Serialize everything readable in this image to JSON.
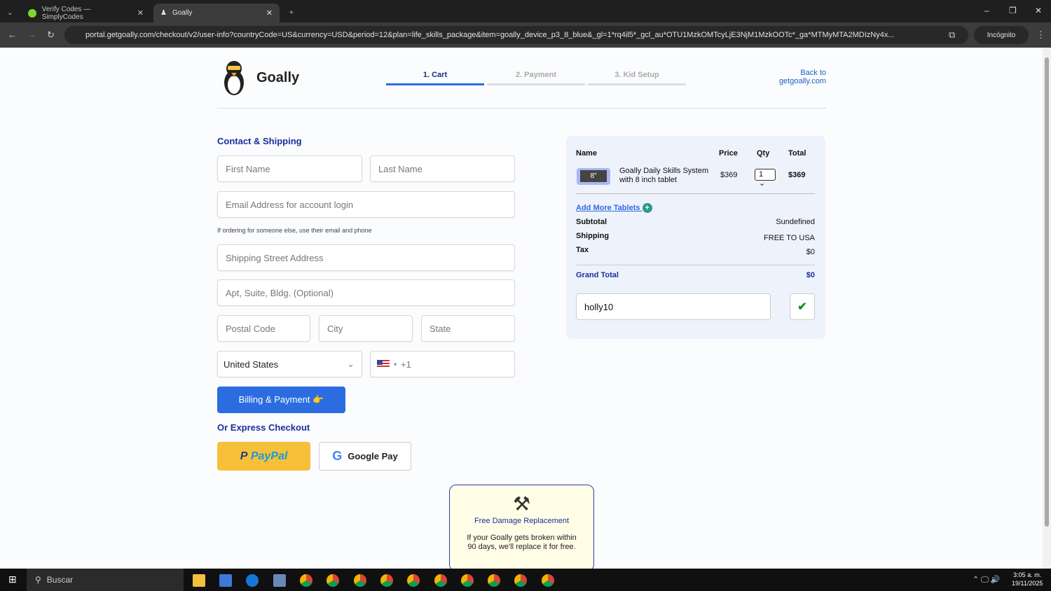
{
  "browser": {
    "tabs": [
      {
        "title": "Verify Codes — SimplyCodes"
      },
      {
        "title": "Goally"
      }
    ],
    "url": "portal.getgoally.com/checkout/v2/user-info?countryCode=US&currency=USD&period=12&plan=life_skills_package&item=goally_device_p3_8_blue&_gl=1*rq4il5*_gcl_au*OTU1MzkOMTcyLjE3NjM1MzkOOTc*_ga*MTMyMTA2MDIzNy4x...",
    "incognito": "Incógnito"
  },
  "header": {
    "brand": "Goally",
    "steps": [
      "1. Cart",
      "2. Payment",
      "3. Kid Setup"
    ],
    "back_line1": "Back to",
    "back_line2": "getgoally.com"
  },
  "form": {
    "section_title": "Contact & Shipping",
    "first_name": "First Name",
    "last_name": "Last Name",
    "email": "Email Address for account login",
    "hint": "If ordering for someone else, use their email and phone",
    "street": "Shipping Street Address",
    "apt": "Apt, Suite, Bldg. (Optional)",
    "postal": "Postal Code",
    "city": "City",
    "state": "State",
    "country": "United States",
    "phone_code": "+1",
    "billing_button": "Billing & Payment 👉",
    "express_title": "Or Express Checkout",
    "paypal": "PayPal",
    "gpay": "Google Pay"
  },
  "cart": {
    "headers": [
      "Name",
      "Price",
      "Qty",
      "Total"
    ],
    "item": {
      "thumb": "8\"",
      "name_line1": "Goally Daily Skills System",
      "name_line2": "with 8 inch tablet",
      "price": "$369",
      "qty": "1",
      "total": "$369"
    },
    "add_more": "Add More Tablets",
    "subtotal_label": "Subtotal",
    "subtotal": "Sundefined",
    "shipping_label": "Shipping",
    "shipping": "FREE TO USA",
    "tax_label": "Tax",
    "tax": "$0",
    "grand_label": "Grand Total",
    "grand": "$0",
    "promo_code": "holly10"
  },
  "damage": {
    "title": "Free Damage Replacement",
    "text1": "If your Goally gets broken within",
    "text2": "90 days, we'll replace it for free."
  },
  "taskbar": {
    "search": "Buscar",
    "time": "3:05 a. m.",
    "date": "19/11/2025"
  }
}
